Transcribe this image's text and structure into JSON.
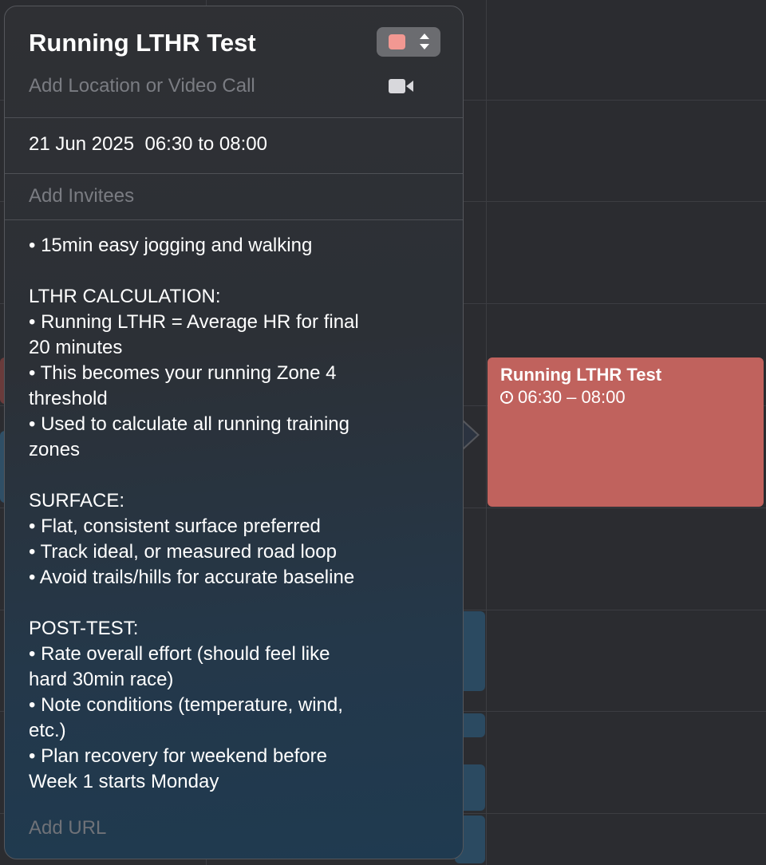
{
  "event": {
    "title": "Running LTHR Test",
    "color": "#f29892",
    "location_placeholder": "Add Location or Video Call",
    "date": "21 Jun 2025",
    "time_range": "06:30 to 08:00",
    "invitees_placeholder": "Add Invitees",
    "url_placeholder": "Add URL",
    "notes": [
      "• 15min easy jogging and walking",
      "",
      "LTHR CALCULATION:",
      "• Running LTHR = Average HR for final",
      "20 minutes",
      "• This becomes your running Zone 4",
      "threshold",
      "• Used to calculate all running training",
      "zones",
      "",
      "SURFACE:",
      "• Flat, consistent surface preferred",
      "• Track ideal, or measured road loop",
      "• Avoid trails/hills for accurate baseline",
      "",
      "POST-TEST:",
      "• Rate overall effort (should feel like",
      "hard 30min race)",
      "• Note conditions (temperature, wind,",
      "etc.)",
      "• Plan recovery for weekend before",
      "Week 1 starts Monday"
    ]
  },
  "calendar_event": {
    "title": "Running LTHR Test",
    "time": "06:30 – 08:00",
    "color": "#c0625d"
  },
  "icons": {
    "color_picker": "chevron-up-down-icon",
    "video": "video-camera-icon",
    "clock": "clock-icon"
  }
}
